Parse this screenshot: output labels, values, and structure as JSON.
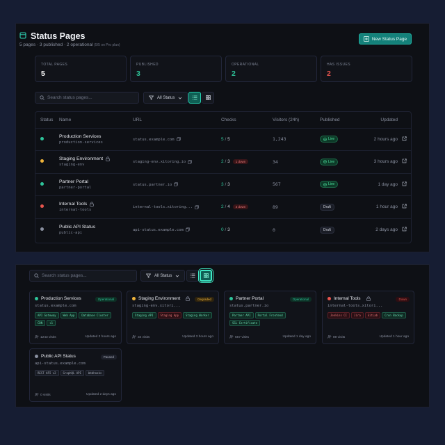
{
  "header": {
    "title": "Status Pages",
    "subtitle": "5 pages · 3 published · 2 operational",
    "plan_note": "(5/5 on Pro plan)",
    "new_button": "New Status Page"
  },
  "stats": [
    {
      "label": "Total Pages",
      "value": "5",
      "color": "#ffffff"
    },
    {
      "label": "Published",
      "value": "3",
      "color": "#2ec49a"
    },
    {
      "label": "Operational",
      "value": "2",
      "color": "#2ec49a"
    },
    {
      "label": "Has Issues",
      "value": "2",
      "color": "#e8554e"
    }
  ],
  "toolbar": {
    "search_placeholder": "Search status pages...",
    "filter_label": "All Status"
  },
  "table": {
    "headers": [
      "Status",
      "Name",
      "URL",
      "Checks",
      "Visitors (24h)",
      "Published",
      "Updated"
    ],
    "rows": [
      {
        "dot": "#2ec49a",
        "name": "Production Services",
        "locked": false,
        "slug": "production-services",
        "url": "status.example.com",
        "checks_up": "5",
        "checks_total": "5",
        "down": "",
        "visitors": "1,243",
        "published": "Live",
        "updated": "2 hours ago"
      },
      {
        "dot": "#f0b43a",
        "name": "Staging Environment",
        "locked": true,
        "slug": "staging-env",
        "url": "staging-env.xitoring.io",
        "checks_up": "2",
        "checks_total": "3",
        "down": "1 down",
        "visitors": "34",
        "published": "Live",
        "updated": "3 hours ago"
      },
      {
        "dot": "#2ec49a",
        "name": "Partner Portal",
        "locked": false,
        "slug": "partner-portal",
        "url": "status.partner.io",
        "checks_up": "3",
        "checks_total": "3",
        "down": "",
        "visitors": "567",
        "published": "Live",
        "updated": "1 day ago"
      },
      {
        "dot": "#e8554e",
        "name": "Internal Tools",
        "locked": true,
        "slug": "internal-tools",
        "url": "internal-tools.xitoring...",
        "checks_up": "2",
        "checks_total": "4",
        "down": "2 down",
        "visitors": "89",
        "published": "Draft",
        "updated": "1 hour ago"
      },
      {
        "dot": "#8a90a0",
        "name": "Public API Status",
        "locked": false,
        "slug": "public-api",
        "url": "api-status.example.com",
        "checks_up": "0",
        "checks_total": "3",
        "down": "",
        "visitors": "0",
        "published": "Draft",
        "updated": "2 days ago"
      }
    ]
  },
  "cards": [
    {
      "dot": "#2ec49a",
      "name": "Production Services",
      "locked": false,
      "state": "Operational",
      "state_color": "#2ec49a",
      "url": "status.example.com",
      "tags": [
        [
          "API Gateway",
          "ok"
        ],
        [
          "Web App",
          "ok"
        ],
        [
          "Database Cluster",
          "ok"
        ],
        [
          "CDN",
          "ok"
        ],
        [
          "+1",
          "ok"
        ]
      ],
      "visits": "1243 visits",
      "updated": "Updated 2 hours ago"
    },
    {
      "dot": "#f0b43a",
      "name": "Staging Environment",
      "locked": true,
      "state": "Degraded",
      "state_color": "#f0b43a",
      "url": "staging-env.xitori...",
      "tags": [
        [
          "Staging API",
          "ok"
        ],
        [
          "Staging App",
          "err"
        ],
        [
          "Staging Worker",
          "ok"
        ]
      ],
      "visits": "34 visits",
      "updated": "Updated 3 hours ago"
    },
    {
      "dot": "#2ec49a",
      "name": "Partner Portal",
      "locked": false,
      "state": "Operational",
      "state_color": "#2ec49a",
      "url": "status.partner.io",
      "tags": [
        [
          "Partner API",
          "ok"
        ],
        [
          "Portal Frontend",
          "ok"
        ],
        [
          "SSL Certificate",
          "ok"
        ]
      ],
      "visits": "567 visits",
      "updated": "Updated 1 day ago"
    },
    {
      "dot": "#e8554e",
      "name": "Internal Tools",
      "locked": true,
      "state": "Down",
      "state_color": "#e8554e",
      "url": "internal-tools.xitori...",
      "tags": [
        [
          "Jenkins CI",
          "err"
        ],
        [
          "Jira",
          "err"
        ],
        [
          "GitLab",
          "err"
        ],
        [
          "Cron Backup",
          "ok"
        ]
      ],
      "visits": "89 visits",
      "updated": "Updated 1 hour ago"
    },
    {
      "dot": "#8a90a0",
      "name": "Public API Status",
      "locked": false,
      "state": "Paused",
      "state_color": "#a9aebb",
      "url": "api-status.example.com",
      "tags": [
        [
          "REST API v2",
          "gray"
        ],
        [
          "GraphQL API",
          "gray"
        ],
        [
          "Webhooks",
          "gray"
        ]
      ],
      "visits": "0 visits",
      "updated": "Updated 2 days ago"
    }
  ]
}
